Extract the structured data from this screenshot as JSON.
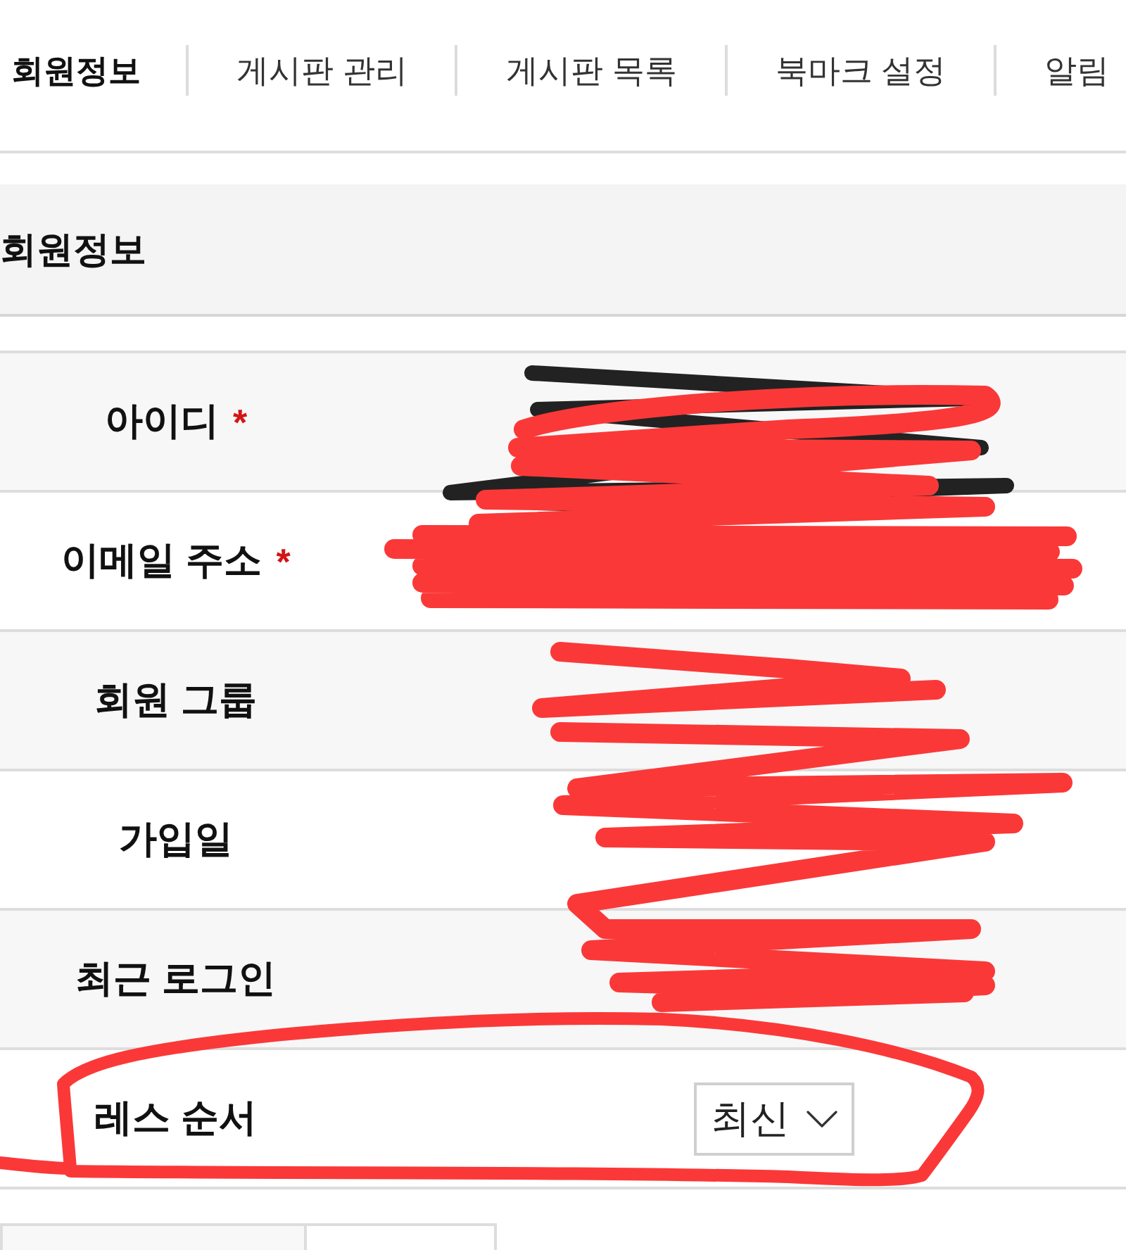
{
  "tabs": [
    {
      "label": "회원정보",
      "selected": true
    },
    {
      "label": "게시판 관리",
      "selected": false
    },
    {
      "label": "게시판 목록",
      "selected": false
    },
    {
      "label": "북마크 설정",
      "selected": false
    },
    {
      "label": "알림",
      "selected": false
    }
  ],
  "section": {
    "title": "회원정보"
  },
  "rows": [
    {
      "kind": "text",
      "label": "아이디",
      "required_mark": "*"
    },
    {
      "kind": "text",
      "label": "이메일 주소",
      "required_mark": "*"
    },
    {
      "kind": "text",
      "label": "회원 그룹"
    },
    {
      "kind": "text",
      "label": "가입일"
    },
    {
      "kind": "text",
      "label": "최근 로그인"
    },
    {
      "kind": "select",
      "label": "레스 순서",
      "value": "최신"
    }
  ]
}
